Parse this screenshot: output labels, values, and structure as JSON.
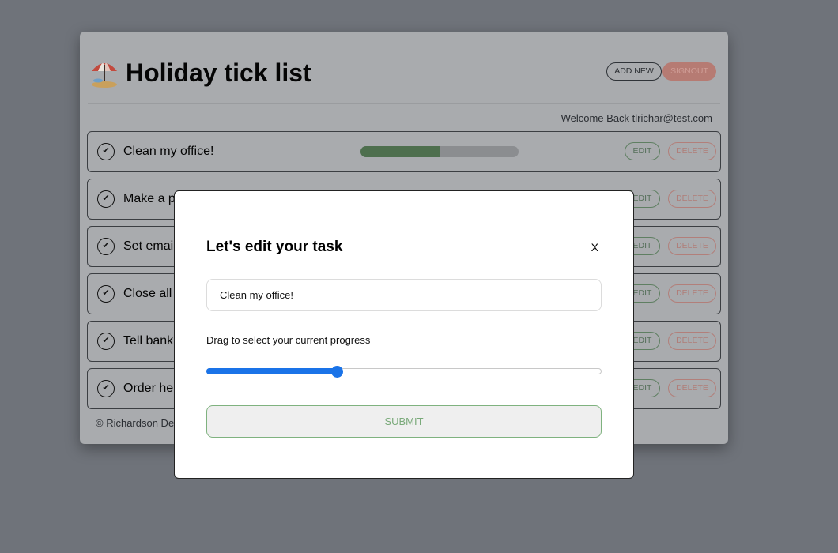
{
  "app": {
    "title": "Holiday tick list",
    "logo_icon": "beach-umbrella-icon",
    "add_new_label": "ADD NEW",
    "signout_label": "SIGNOUT",
    "welcome_text": "Welcome Back tlrichar@test.com",
    "footer_text": "© Richardson De",
    "edit_label": "EDIT",
    "delete_label": "DELETE",
    "tasks": [
      {
        "name": "Clean my office!",
        "progress": 0.5
      },
      {
        "name": "Make a p"
      },
      {
        "name": "Set emai"
      },
      {
        "name": "Close all"
      },
      {
        "name": "Tell bank"
      },
      {
        "name": "Order he"
      }
    ]
  },
  "modal": {
    "title": "Let's edit your task",
    "close_label": "X",
    "task_value": "Clean my office!",
    "progress_label": "Drag to select your current progress",
    "progress_value": 0.33,
    "submit_label": "SUBMIT"
  },
  "colors": {
    "accent": "#1a73e8",
    "overlay": "#6f737a",
    "progress_fill": "#4e6f4e",
    "submit_border": "#7fb27f"
  }
}
